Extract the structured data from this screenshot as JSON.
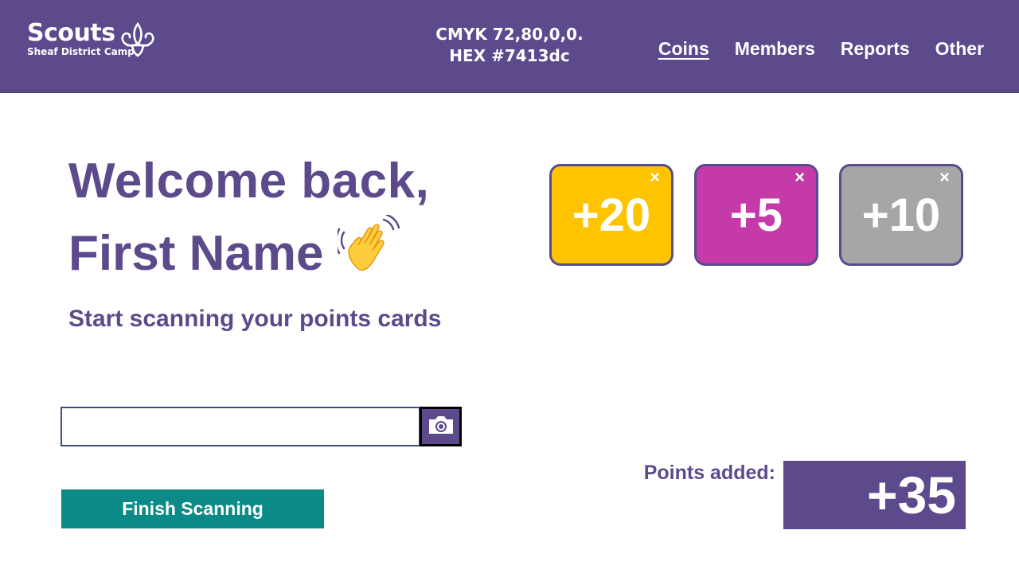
{
  "header": {
    "logo": {
      "word": "Scouts",
      "sub": "Sheaf District Camp",
      "icon": "fleur-de-lis-icon"
    },
    "color_info": {
      "cmyk": "CMYK 72,80,0,0.",
      "hex": "HEX #7413dc"
    },
    "nav": [
      {
        "label": "Coins",
        "active": true
      },
      {
        "label": "Members",
        "active": false
      },
      {
        "label": "Reports",
        "active": false
      },
      {
        "label": "Other",
        "active": false
      }
    ]
  },
  "welcome": {
    "line1": "Welcome back,",
    "line2": "First Name",
    "emoji_icon": "waving-hand-icon",
    "subtitle": "Start scanning your points cards"
  },
  "cards": [
    {
      "label": "+20",
      "color": "#ffc400",
      "close": "×"
    },
    {
      "label": "+5",
      "color": "#c43aa8",
      "close": "×"
    },
    {
      "label": "+10",
      "color": "#a6a6a6",
      "close": "×"
    }
  ],
  "scan": {
    "input_value": "",
    "camera_icon": "camera-icon"
  },
  "finish_button": "Finish Scanning",
  "points": {
    "label": "Points added:",
    "value": "+35"
  },
  "colors": {
    "brand_purple": "#5c4a8c",
    "teal": "#0b8a87"
  }
}
